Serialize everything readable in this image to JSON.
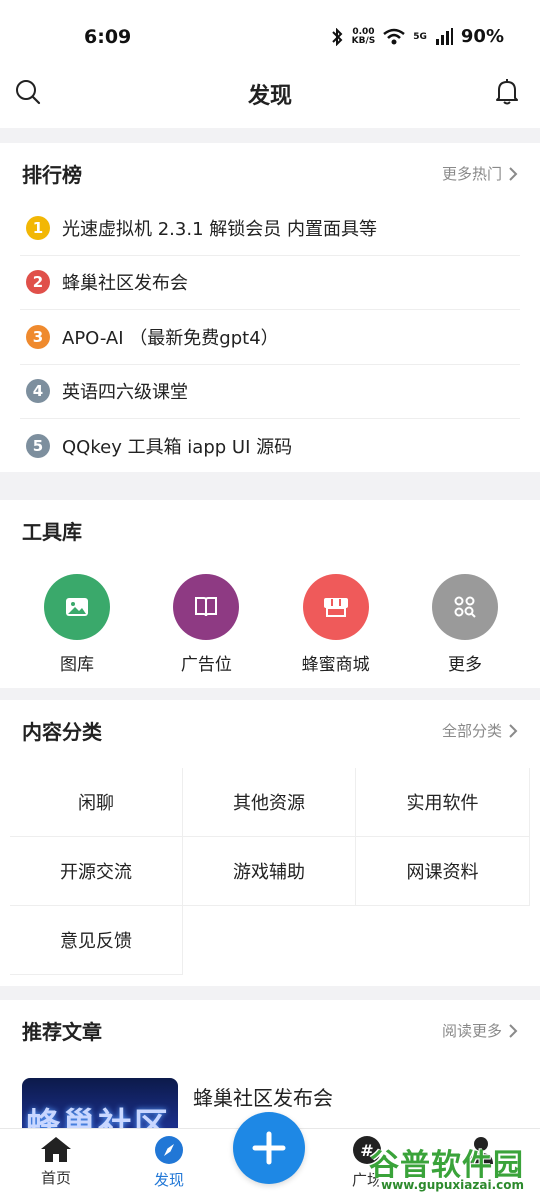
{
  "status": {
    "time": "6:09",
    "net_speed_top": "0.00",
    "net_speed_unit": "KB/S",
    "network": "5G",
    "battery": "90%"
  },
  "navbar": {
    "title": "发现"
  },
  "ranking": {
    "title": "排行榜",
    "more": "更多热门",
    "items": [
      {
        "rank": "1",
        "text": "光速虚拟机 2.3.1 解锁会员 内置面具等",
        "color": "#f2b705"
      },
      {
        "rank": "2",
        "text": "蜂巢社区发布会",
        "color": "#e0504a"
      },
      {
        "rank": "3",
        "text": "APO-AI （最新免费gpt4）",
        "color": "#ef8a2e"
      },
      {
        "rank": "4",
        "text": "英语四六级课堂",
        "color": "#7d8f9e"
      },
      {
        "rank": "5",
        "text": "QQkey 工具箱 iapp UI 源码",
        "color": "#7d8f9e"
      }
    ]
  },
  "tools": {
    "title": "工具库",
    "items": [
      {
        "label": "图库",
        "color": "#3aa96b",
        "icon": "image-icon"
      },
      {
        "label": "广告位",
        "color": "#8e3a83",
        "icon": "book-icon"
      },
      {
        "label": "蜂蜜商城",
        "color": "#ef5a5a",
        "icon": "store-icon"
      },
      {
        "label": "更多",
        "color": "#9a9a9a",
        "icon": "grid-search-icon"
      }
    ]
  },
  "categories": {
    "title": "内容分类",
    "more": "全部分类",
    "items": [
      "闲聊",
      "其他资源",
      "实用软件",
      "开源交流",
      "游戏辅助",
      "网课资料",
      "意见反馈"
    ]
  },
  "articles": {
    "title": "推荐文章",
    "more": "阅读更多",
    "items": [
      {
        "title": "蜂巢社区发布会",
        "thumb_text": "蜂巢社区"
      }
    ]
  },
  "tabbar": {
    "tabs": [
      {
        "label": "首页"
      },
      {
        "label": "发现"
      },
      {
        "label": "广场"
      },
      {
        "label": ""
      }
    ]
  },
  "watermark": {
    "text": "谷普软件园",
    "url": "www.gupuxiazai.com"
  },
  "colors": {
    "accent": "#2177d6",
    "fab": "#1e88e5"
  }
}
